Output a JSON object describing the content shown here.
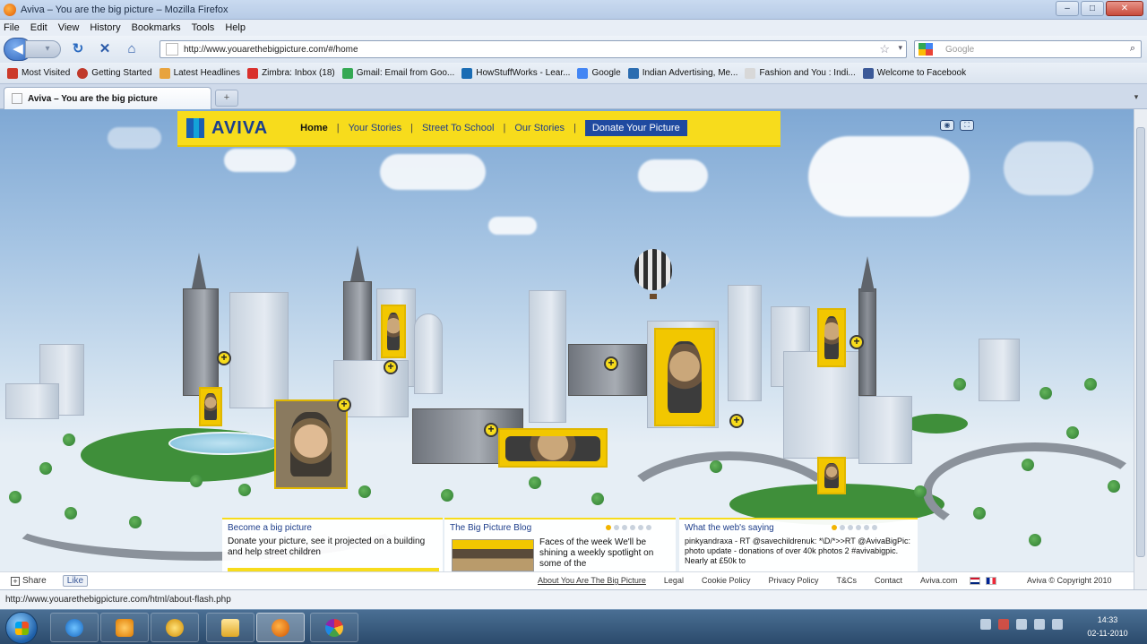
{
  "window": {
    "title": "Aviva – You are the big picture – Mozilla Firefox",
    "controls": [
      "–",
      "□",
      "✕"
    ]
  },
  "menu": [
    "File",
    "Edit",
    "View",
    "History",
    "Bookmarks",
    "Tools",
    "Help"
  ],
  "nav": {
    "url": "http://www.youarethebigpicture.com/#/home",
    "search_placeholder": "Google"
  },
  "bookmarks": [
    {
      "label": "Most Visited",
      "color": "#cc3a2a"
    },
    {
      "label": "Getting Started",
      "color": "#c0392b"
    },
    {
      "label": "Latest Headlines",
      "color": "#e8a33d"
    },
    {
      "label": "Zimbra: Inbox (18)",
      "color": "#d9302c"
    },
    {
      "label": "Gmail: Email from Goo...",
      "color": "#34a853"
    },
    {
      "label": "HowStuffWorks - Lear...",
      "color": "#1a6cb4"
    },
    {
      "label": "Google",
      "color": "#4285f4"
    },
    {
      "label": "Indian Advertising, Me...",
      "color": "#2b6cb0"
    },
    {
      "label": "Fashion and You : Indi...",
      "color": "#d8d8d8"
    },
    {
      "label": "Welcome to Facebook",
      "color": "#3b5998"
    }
  ],
  "tab": {
    "label": "Aviva – You are the big picture",
    "new_tab": "+"
  },
  "aviva": {
    "logo": "AVIVA",
    "nav": [
      "Home",
      "Your Stories",
      "Street To School",
      "Our Stories"
    ],
    "separator": "|",
    "donate": "Donate Your Picture"
  },
  "panels": {
    "big_picture": {
      "title": "Become a big picture",
      "text": "Donate your picture, see it projected on a building and help street children"
    },
    "blog": {
      "title": "The Big Picture Blog",
      "text": "Faces of the week We'll be shining a weekly spotlight on some of the"
    },
    "web": {
      "title": "What the web's saying",
      "text": "pinkyandraxa - RT @savechildrenuk: *\\D/*>>RT @AvivaBigPic: photo update - donations of over 40k photos 2 #avivabigpic. Nearly at £50k to"
    }
  },
  "footer": {
    "share": "Share",
    "like": "Like",
    "links": [
      "About You Are The Big Picture",
      "Legal",
      "Cookie Policy",
      "Privacy Policy",
      "T&Cs",
      "Contact",
      "Aviva.com"
    ],
    "copyright": "Aviva © Copyright 2010"
  },
  "status": "http://www.youarethebigpicture.com/html/about-flash.php",
  "clock": {
    "time": "14:33",
    "date": "02-11-2010"
  },
  "colors": {
    "aviva_yellow": "#f7dc1c",
    "aviva_blue": "#1d3d8a",
    "sky": "#a8c6e4"
  }
}
